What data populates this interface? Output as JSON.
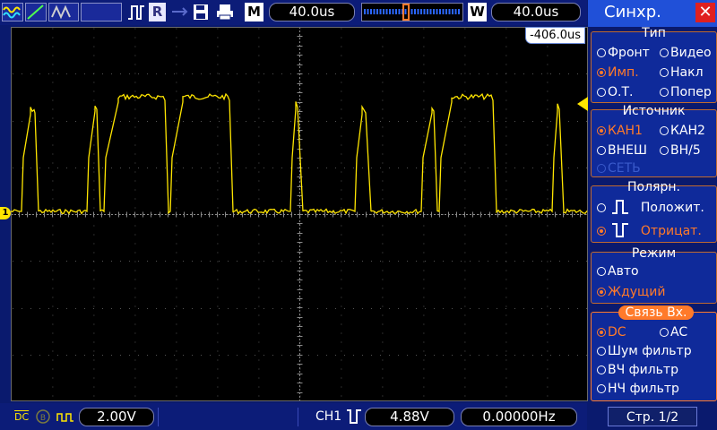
{
  "toolbar": {
    "run_mode_label": "R",
    "memory_label": "M",
    "horizontal_position": "40.0us",
    "window_label": "W",
    "timebase": "40.0us"
  },
  "screen": {
    "trigger_offset": "-406.0us",
    "channel_marker": "1"
  },
  "status": {
    "coupling_label": "DC",
    "ch1_scale": "2.00V",
    "trigger_source": "CH1",
    "trigger_level": "4.88V",
    "frequency": "0.00000Hz"
  },
  "menu": {
    "title": "Синхр.",
    "type_group": {
      "title": "Тип",
      "options": [
        "Фронт",
        "Видео",
        "Имп.",
        "Накл",
        "О.Т.",
        "Попер"
      ],
      "selected": "Имп."
    },
    "source_group": {
      "title": "Источник",
      "options": [
        "КАН1",
        "КАН2",
        "ВНЕШ",
        "ВН/5",
        "СЕТЬ"
      ],
      "selected": "КАН1"
    },
    "polarity_group": {
      "title": "Полярн.",
      "options": [
        "Положит.",
        "Отрицат."
      ],
      "selected": "Отрицат."
    },
    "mode_group": {
      "title": "Режим",
      "options": [
        "Авто",
        "Ждущий"
      ],
      "selected": "Ждущий"
    },
    "coupling_group": {
      "title": "Связь  Вх.",
      "options": [
        "DC",
        "AC",
        "Шум  фильтр",
        "ВЧ  фильтр",
        "НЧ  фильтр"
      ],
      "selected": "DC"
    },
    "page": "Стр.  1/2"
  },
  "colors": {
    "trace": "#ffe600",
    "menu_selected": "#ff7a2a",
    "menu_title_bg": "#2050d8"
  }
}
